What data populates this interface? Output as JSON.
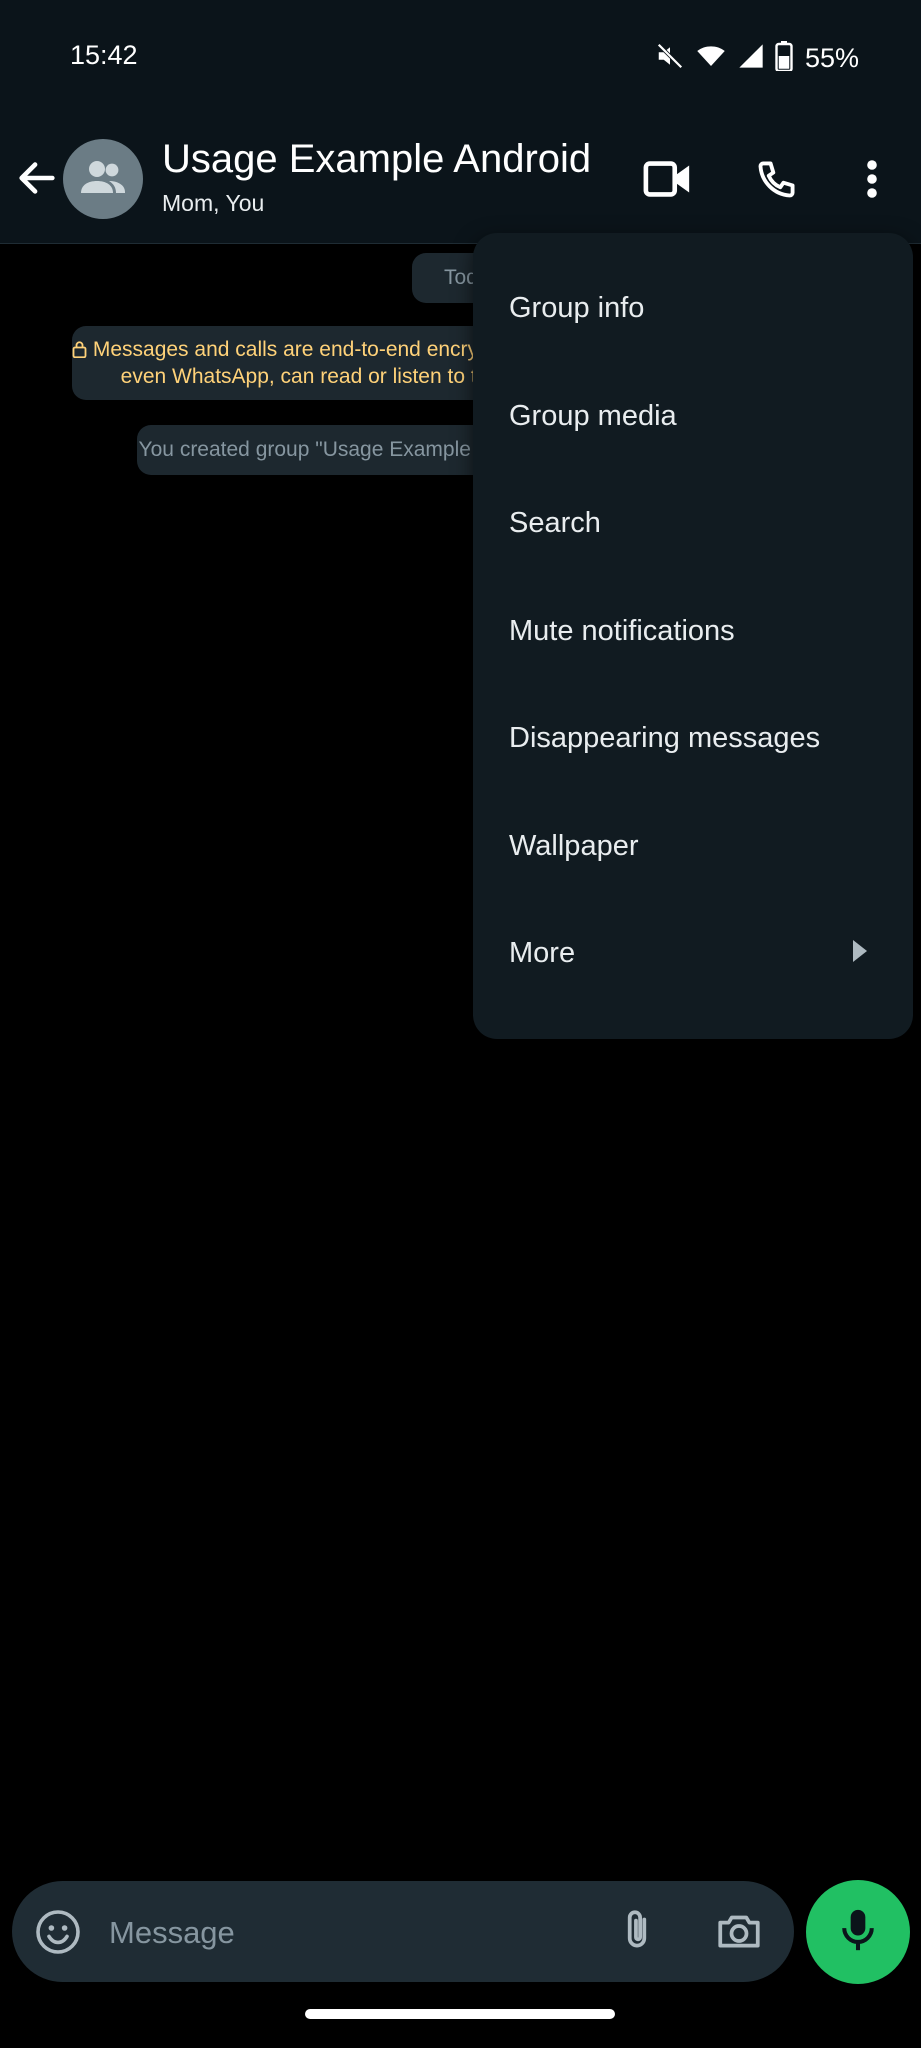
{
  "status_bar": {
    "time": "15:42",
    "battery": "55%"
  },
  "header": {
    "title": "Usage Example Android",
    "subtitle": "Mom, You"
  },
  "chat": {
    "date_chip": "Today",
    "encryption_line1": "Messages and calls are end-to-end encrypted. No one outside of this chat,",
    "encryption_line2": "even WhatsApp, can read or listen to them.",
    "system_message": "You created group \"Usage Example Android\""
  },
  "menu": {
    "items": [
      {
        "label": "Group info"
      },
      {
        "label": "Group media"
      },
      {
        "label": "Search"
      },
      {
        "label": "Mute notifications"
      },
      {
        "label": "Disappearing messages"
      },
      {
        "label": "Wallpaper"
      },
      {
        "label": "More"
      }
    ]
  },
  "composer": {
    "placeholder": "Message"
  },
  "colors": {
    "background": "#000000",
    "bar": "#0b141a",
    "menu": "#111b21",
    "bubble": "#1d282f",
    "accent_green": "#21c063",
    "encryption_text": "#ffd279"
  }
}
